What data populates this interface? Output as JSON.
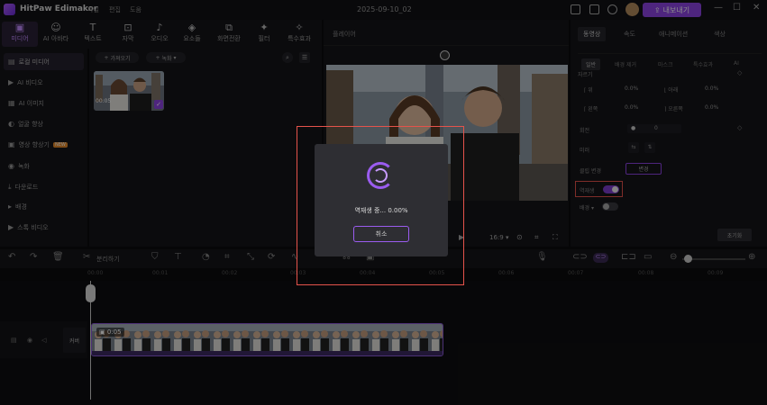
{
  "titlebar": {
    "app_name": "HitPaw Edimakor",
    "menu": [
      "파일",
      "편집",
      "도움"
    ],
    "project_title": "2025-09-10_02",
    "export_label": "내보내기"
  },
  "tools": [
    {
      "label": "미디어",
      "icon": "media-icon"
    },
    {
      "label": "AI 아바타",
      "icon": "ai-avatar-icon"
    },
    {
      "label": "텍스트",
      "icon": "text-icon"
    },
    {
      "label": "자막",
      "icon": "subtitle-icon"
    },
    {
      "label": "오디오",
      "icon": "audio-icon"
    },
    {
      "label": "요소들",
      "icon": "elements-icon"
    },
    {
      "label": "화면전환",
      "icon": "transition-icon"
    },
    {
      "label": "필터",
      "icon": "filter-icon"
    },
    {
      "label": "특수효과",
      "icon": "effects-icon"
    }
  ],
  "sidebar": {
    "items": [
      {
        "label": "로컬 미디어"
      },
      {
        "label": "AI 비디오"
      },
      {
        "label": "AI 이미지"
      },
      {
        "label": "얼굴 향상"
      },
      {
        "label": "영상 향상기",
        "badge": "NEW"
      },
      {
        "label": "녹화"
      },
      {
        "label": "다운로드"
      },
      {
        "label": "배경"
      },
      {
        "label": "스톡 비디오"
      }
    ]
  },
  "media": {
    "import_label": "가져오기",
    "record_label": "녹화",
    "thumb_duration": "00:05"
  },
  "player": {
    "label": "플레이어",
    "aspect": "16:9"
  },
  "props": {
    "tabs": [
      "동영상",
      "속도",
      "애니메이션",
      "색상"
    ],
    "subtabs": [
      "일반",
      "배경 제거",
      "마스크",
      "특수효과",
      "AI"
    ],
    "crop_label": "자르기",
    "fields": [
      {
        "label": "위",
        "value": "0.0%"
      },
      {
        "label": "아래",
        "value": "0.0%"
      },
      {
        "label": "왼쪽",
        "value": "0.0%"
      },
      {
        "label": "오른쪽",
        "value": "0.0%"
      }
    ],
    "rotate_label": "회전",
    "rotate_value": "0",
    "mirror_label": "미러",
    "clip_change_label": "클립 변경",
    "change_btn": "변경",
    "reverse_label": "역재생",
    "background_label": "배경",
    "reset_label": "초기화"
  },
  "timeline": {
    "split_label": "분리하기",
    "ticks": [
      "00:00",
      "00:01",
      "00:02",
      "00:03",
      "00:04",
      "00:05",
      "00:06",
      "00:07",
      "00:08",
      "00:09"
    ],
    "clip_duration": "0:05",
    "track_label": "커버"
  },
  "dialog": {
    "progress_text": "역재생 중... 0.00%",
    "cancel_label": "취소"
  }
}
